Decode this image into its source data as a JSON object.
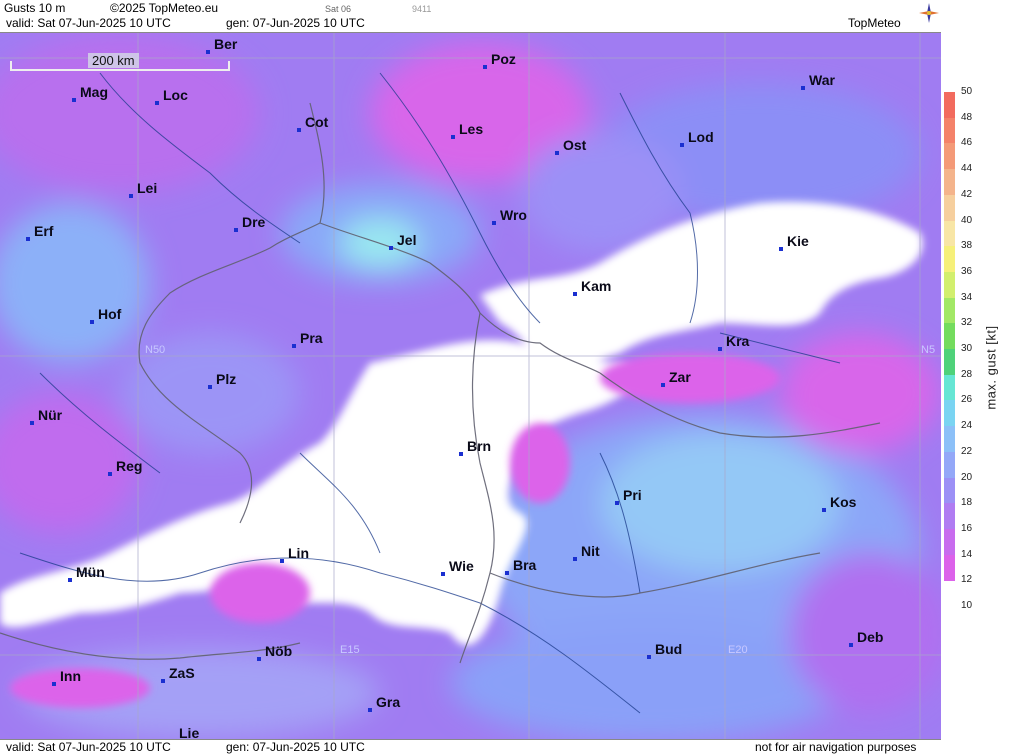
{
  "header": {
    "title": "Gusts 10 m",
    "copyright": "©2025 TopMeteo.eu",
    "valid": "valid:  Sat  07-Jun-2025  10 UTC",
    "gen": "gen:  07-Jun-2025 10 UTC",
    "sat": "Sat 06",
    "code": "9411",
    "logo": "TopMeteo"
  },
  "footer": {
    "valid": "valid:  Sat  07-Jun-2025  10 UTC",
    "gen": "gen:  07-Jun-2025 10 UTC",
    "disclaimer": "not for air navigation purposes"
  },
  "scale": {
    "label": "200 km"
  },
  "grid_labels": {
    "n50_left": "N50",
    "n50_right": "N5",
    "e15": "E15",
    "e20": "E20"
  },
  "cities": [
    {
      "name": "Ber"
    },
    {
      "name": "Poz"
    },
    {
      "name": "Mag"
    },
    {
      "name": "Loc"
    },
    {
      "name": "War"
    },
    {
      "name": "Cot"
    },
    {
      "name": "Les"
    },
    {
      "name": "Lod"
    },
    {
      "name": "Ost"
    },
    {
      "name": "Lei"
    },
    {
      "name": "Wro"
    },
    {
      "name": "Dre"
    },
    {
      "name": "Erf"
    },
    {
      "name": "Jel"
    },
    {
      "name": "Kie"
    },
    {
      "name": "Kam"
    },
    {
      "name": "Hof"
    },
    {
      "name": "Pra"
    },
    {
      "name": "Kra"
    },
    {
      "name": "Plz"
    },
    {
      "name": "Zar"
    },
    {
      "name": "Nür"
    },
    {
      "name": "Brn"
    },
    {
      "name": "Reg"
    },
    {
      "name": "Pri"
    },
    {
      "name": "Kos"
    },
    {
      "name": "Lin"
    },
    {
      "name": "Nit"
    },
    {
      "name": "Wie"
    },
    {
      "name": "Bra"
    },
    {
      "name": "Mün"
    },
    {
      "name": "Deb"
    },
    {
      "name": "Nöb"
    },
    {
      "name": "Bud"
    },
    {
      "name": "Inn"
    },
    {
      "name": "ZaS"
    },
    {
      "name": "Gra"
    },
    {
      "name": "Lie"
    }
  ],
  "legend": {
    "title": "max. gust  [kt]",
    "ticks": [
      "50",
      "48",
      "46",
      "44",
      "42",
      "40",
      "38",
      "36",
      "34",
      "32",
      "30",
      "28",
      "26",
      "24",
      "22",
      "20",
      "18",
      "16",
      "14",
      "12",
      "10"
    ],
    "colors": [
      "#f26b5e",
      "#f4826a",
      "#f49a78",
      "#f4b48c",
      "#f6cf9e",
      "#f8e6a6",
      "#f6f07a",
      "#d2ef6e",
      "#a2e866",
      "#74dc5e",
      "#4fd27a",
      "#66e6d4",
      "#7ad4f2",
      "#8cc0f8",
      "#94a8f8",
      "#9c90f6",
      "#b07cf2",
      "#c86cee",
      "#dc62ea"
    ]
  }
}
